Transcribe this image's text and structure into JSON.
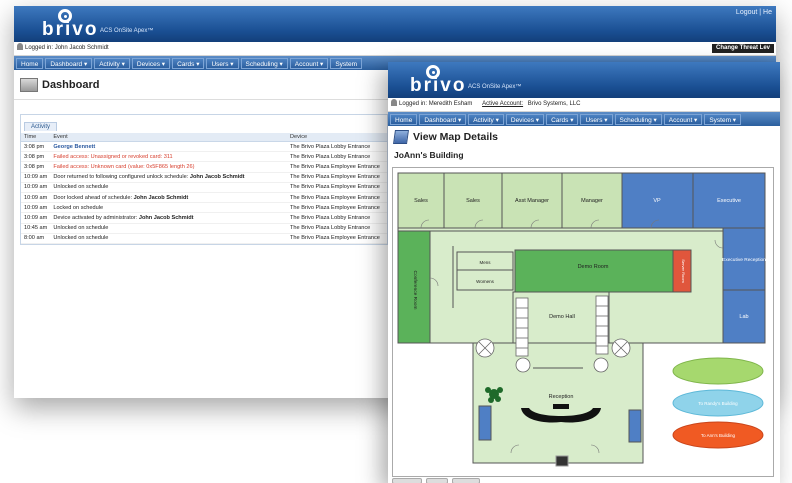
{
  "back_window": {
    "logo": "brivo",
    "tagline": "ACS OnSite Apex™",
    "logout": "Logout | He",
    "logged_in": "Logged in: John Jacob Schmidt",
    "threat_button": "Change Threat Lev",
    "nav": [
      "Home",
      "Dashboard ▾",
      "Activity ▾",
      "Devices ▾",
      "Cards ▾",
      "Users ▾",
      "Scheduling ▾",
      "Account ▾",
      "System"
    ],
    "page_title": "Dashboard",
    "activity_tab": "Activity",
    "columns": [
      "Time",
      "Event",
      "Device"
    ],
    "rows": [
      {
        "time": "3:08 pm",
        "event": "George Bennett",
        "device": "The Brivo Plaza Lobby Entrance",
        "style": "blue"
      },
      {
        "time": "3:08 pm",
        "event": "Failed access: Unassigned or revoked card: 311",
        "device": "The Brivo Plaza Lobby Entrance",
        "style": "red"
      },
      {
        "time": "3:08 pm",
        "event": "Failed access: Unknown card (value: 0x5F865 length 26)",
        "device": "The Brivo Plaza Employee Entrance",
        "style": "red"
      },
      {
        "time": "10:09 am",
        "event": "Door returned to following configured unlock schedule: ",
        "event_bold": "John Jacob Schmidt",
        "device": "The Brivo Plaza Employee Entrance",
        "style": "normal"
      },
      {
        "time": "10:09 am",
        "event": "Unlocked on schedule",
        "device": "The Brivo Plaza Employee Entrance",
        "style": "normal"
      },
      {
        "time": "10:09 am",
        "event": "Door locked ahead of schedule: ",
        "event_bold": "John Jacob Schmidt",
        "device": "The Brivo Plaza Employee Entrance",
        "style": "normal"
      },
      {
        "time": "10:09 am",
        "event": "Locked on schedule",
        "device": "The Brivo Plaza Employee Entrance",
        "style": "normal"
      },
      {
        "time": "10:09 am",
        "event": "Device activated by administrator: ",
        "event_bold": "John Jacob Schmidt",
        "device": "The Brivo Plaza Lobby Entrance",
        "style": "normal"
      },
      {
        "time": "10:45 am",
        "event": "Unlocked on schedule",
        "device": "The Brivo Plaza Lobby Entrance",
        "style": "normal"
      },
      {
        "time": "8:00 am",
        "event": "Unlocked on schedule",
        "device": "The Brivo Plaza Employee Entrance",
        "style": "normal"
      }
    ]
  },
  "front_window": {
    "logo": "brivo",
    "tagline": "ACS OnSite Apex™",
    "logged_in": "Logged in: Meredith Esham",
    "active_account_label": "Active Account:",
    "active_account": "Brivo Systems, LLC",
    "nav": [
      "Home",
      "Dashboard ▾",
      "Activity ▾",
      "Devices ▾",
      "Cards ▾",
      "Users ▾",
      "Scheduling ▾",
      "Account ▾",
      "System ▾"
    ],
    "page_title": "View Map Details",
    "building": "JoAnn's Building",
    "map": {
      "rooms": {
        "sales1": "Sales",
        "sales2": "Sales",
        "asst_manager": "Asst Manager",
        "manager": "Manager",
        "vp": "VP",
        "executive": "Executive",
        "executive_reception": "Executive Reception",
        "lab": "Lab",
        "conference": "Conference Room",
        "demo_room": "Demo Room",
        "server_room": "Server Room",
        "mens": "Mens",
        "womens": "Womens",
        "demo_hall": "Demo Hall",
        "reception": "Reception"
      },
      "buttons": {
        "btn1": "",
        "btn2": "To Randy's Building",
        "btn3": "To Ann's Building"
      },
      "colors": {
        "room_green": "#c9e3b5",
        "active_green": "#5bb25a",
        "room_blue": "#4f7fc5",
        "server_red": "#e0563c",
        "floor_light": "#d8eccb"
      }
    }
  }
}
